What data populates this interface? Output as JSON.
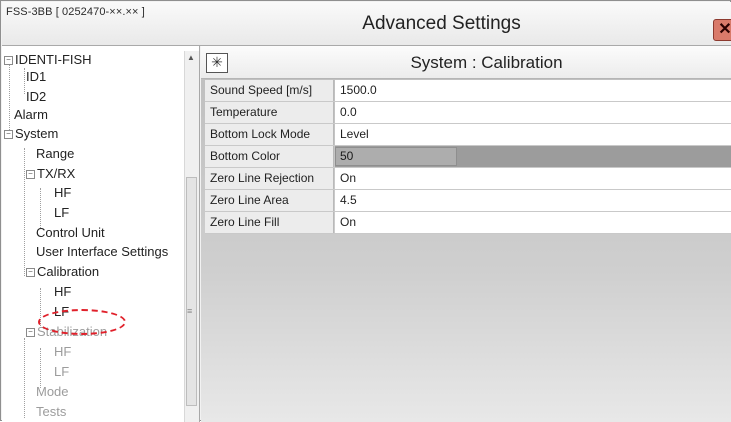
{
  "window": {
    "app_id": "FSS-3BB [ 0252470-××.×× ]",
    "title": "Advanced Settings",
    "close_label": "✕"
  },
  "tree": {
    "items": [
      {
        "label": "IDENTI-FISH",
        "expander": "−"
      },
      {
        "label": "ID1"
      },
      {
        "label": "ID2"
      },
      {
        "label": "Alarm"
      },
      {
        "label": "System",
        "expander": "−"
      },
      {
        "label": "Range"
      },
      {
        "label": "TX/RX",
        "expander": "−"
      },
      {
        "label": "HF"
      },
      {
        "label": "LF"
      },
      {
        "label": "Control Unit"
      },
      {
        "label": "User Interface Settings"
      },
      {
        "label": "Calibration",
        "expander": "−"
      },
      {
        "label": "HF"
      },
      {
        "label": "LF"
      },
      {
        "label": "Stabilization",
        "expander": "−"
      },
      {
        "label": "HF"
      },
      {
        "label": "LF"
      },
      {
        "label": "Mode"
      },
      {
        "label": "Tests"
      }
    ]
  },
  "panel": {
    "title": "System : Calibration",
    "icon": "✳"
  },
  "grid": {
    "rows": [
      {
        "label": "Sound Speed [m/s]",
        "value": "1500.0"
      },
      {
        "label": "Temperature",
        "value": "0.0"
      },
      {
        "label": "Bottom Lock Mode",
        "value": "Level"
      },
      {
        "label": "Bottom Color",
        "value": "50"
      },
      {
        "label": "Zero Line Rejection",
        "value": "On"
      },
      {
        "label": "Zero Line Area",
        "value": "4.5"
      },
      {
        "label": "Zero Line Fill",
        "value": "On"
      }
    ]
  },
  "colors": {
    "callout": "#e0202a",
    "disabled_row": "#9c9c9c",
    "close_button": "#d97a6a"
  }
}
